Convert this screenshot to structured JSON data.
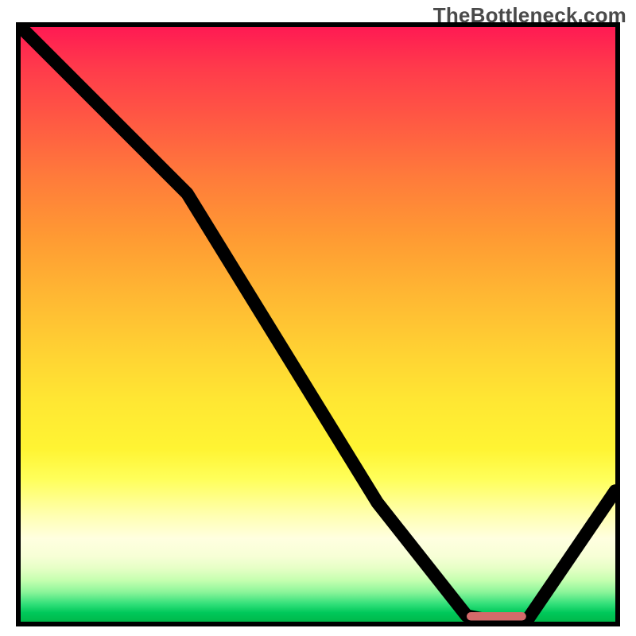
{
  "watermark": "TheBottleneck.com",
  "chart_data": {
    "type": "line",
    "title": "",
    "xlabel": "",
    "ylabel": "",
    "xlim": [
      0,
      100
    ],
    "ylim": [
      0,
      100
    ],
    "grid": false,
    "series": [
      {
        "name": "curve",
        "x": [
          0,
          22,
          28,
          60,
          75,
          80,
          85,
          100
        ],
        "values": [
          100,
          78,
          72,
          20,
          1,
          0,
          0,
          22
        ]
      }
    ],
    "annotations": [
      {
        "name": "optimal-region",
        "type": "bar",
        "x_start": 75,
        "x_end": 85,
        "y": 0.5
      }
    ],
    "background_gradient": {
      "stops": [
        {
          "pos": 0.0,
          "color": "#ff1a53"
        },
        {
          "pos": 0.5,
          "color": "#ffd333"
        },
        {
          "pos": 0.8,
          "color": "#ffffb0"
        },
        {
          "pos": 0.95,
          "color": "#8cf59a"
        },
        {
          "pos": 1.0,
          "color": "#00b84a"
        }
      ]
    }
  }
}
